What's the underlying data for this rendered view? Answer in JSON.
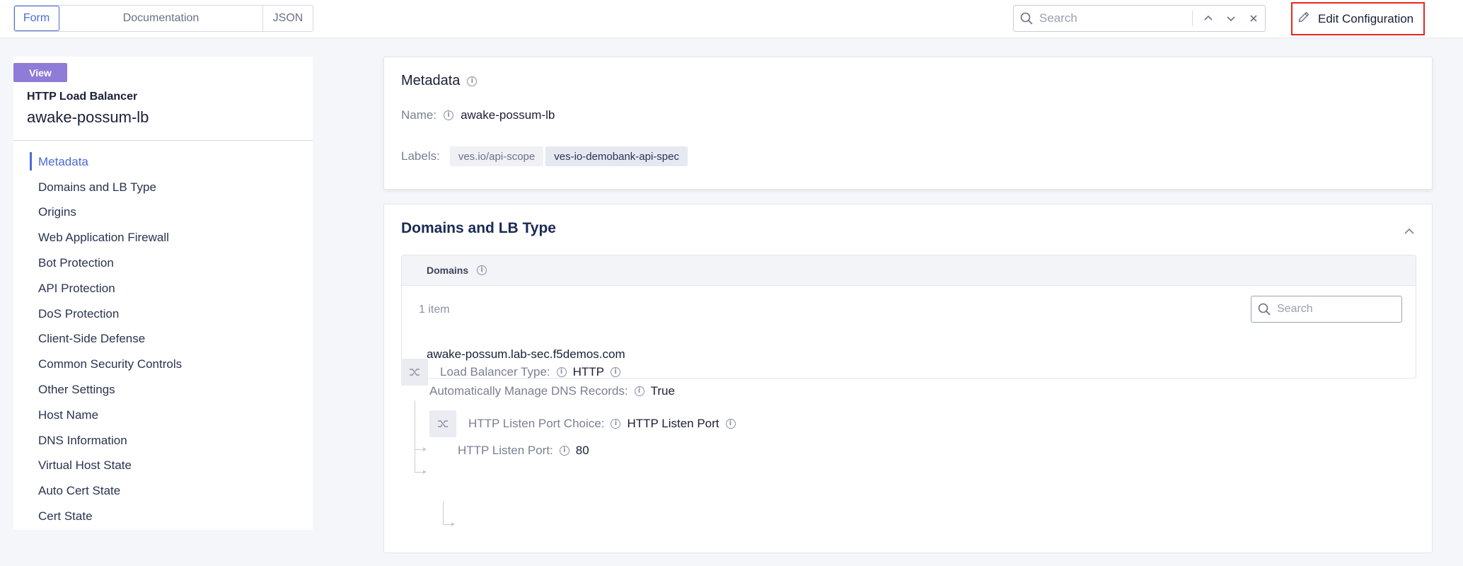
{
  "topbar": {
    "tabs": [
      {
        "label": "Form",
        "active": true
      },
      {
        "label": "Documentation",
        "active": false
      },
      {
        "label": "JSON",
        "active": false
      }
    ],
    "search": {
      "placeholder": "Search"
    },
    "edit_button": {
      "label": "Edit Configuration"
    }
  },
  "sidebar": {
    "badge": "View",
    "object_type": "HTTP Load Balancer",
    "object_name": "awake-possum-lb",
    "nav": [
      {
        "label": "Metadata",
        "active": true
      },
      {
        "label": "Domains and LB Type"
      },
      {
        "label": "Origins"
      },
      {
        "label": "Web Application Firewall"
      },
      {
        "label": "Bot Protection"
      },
      {
        "label": "API Protection"
      },
      {
        "label": "DoS Protection"
      },
      {
        "label": "Client-Side Defense"
      },
      {
        "label": "Common Security Controls"
      },
      {
        "label": "Other Settings"
      },
      {
        "label": "Host Name"
      },
      {
        "label": "DNS Information"
      },
      {
        "label": "Virtual Host State"
      },
      {
        "label": "Auto Cert State"
      },
      {
        "label": "Cert State"
      }
    ]
  },
  "metadata": {
    "title": "Metadata",
    "name_label": "Name:",
    "name_value": "awake-possum-lb",
    "labels_label": "Labels:",
    "label_key": "ves.io/api-scope",
    "label_value": "ves-io-demobank-api-spec"
  },
  "domains_section": {
    "title": "Domains and LB Type",
    "domains_header": "Domains",
    "count": "1 item",
    "search_placeholder": "Search",
    "domains": [
      "awake-possum.lab-sec.f5demos.com"
    ],
    "lb_type_label": "Load Balancer Type:",
    "lb_type_value": "HTTP",
    "dns_label": "Automatically Manage DNS Records:",
    "dns_value": "True",
    "port_choice_label": "HTTP Listen Port Choice:",
    "port_choice_value": "HTTP Listen Port",
    "port_label": "HTTP Listen Port:",
    "port_value": "80"
  },
  "colors": {
    "accent": "#4b6bd5",
    "badge": "#8f7bd8",
    "highlight_border": "#e8281e"
  }
}
